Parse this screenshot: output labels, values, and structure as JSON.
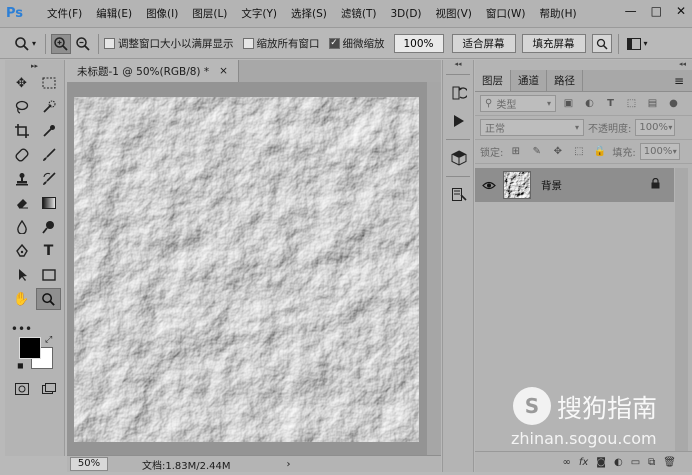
{
  "app": {
    "logo_text": "Ps",
    "menu": [
      "文件(F)",
      "编辑(E)",
      "图像(I)",
      "图层(L)",
      "文字(Y)",
      "选择(S)",
      "滤镜(T)",
      "3D(D)",
      "视图(V)",
      "窗口(W)",
      "帮助(H)"
    ],
    "window_controls": {
      "minimize": "—",
      "maximize": "□",
      "close": "✕"
    }
  },
  "options": {
    "resize_windows_label": "调整窗口大小以满屏显示",
    "resize_windows_checked": false,
    "zoom_all_windows_label": "缩放所有窗口",
    "zoom_all_windows_checked": false,
    "scrubby_zoom_label": "细微缩放",
    "scrubby_zoom_checked": true,
    "zoom_value": "100%",
    "fit_screen_label": "适合屏幕",
    "fill_screen_label": "填充屏幕"
  },
  "document": {
    "tab_title": "未标题-1 @ 50%(RGB/8) *",
    "tab_close": "×",
    "status_zoom": "50%",
    "status_info": "文档:1.83M/2.44M",
    "status_arrow": "›"
  },
  "layers_panel": {
    "tabs": [
      "图层",
      "通道",
      "路径"
    ],
    "active_tab": 0,
    "filter_kind": "类型",
    "blend_mode": "正常",
    "opacity_label": "不透明度:",
    "opacity_value": "100%",
    "lock_label": "锁定:",
    "fill_label": "填充:",
    "fill_value": "100%",
    "layers": [
      {
        "name": "背景",
        "visible": true,
        "locked": true
      }
    ]
  },
  "watermark": {
    "title": "搜狗指南",
    "url": "zhinan.sogou.com"
  },
  "colors": {
    "foreground": "#000000",
    "background": "#ffffff",
    "ps_blue": "#2c7fd6"
  }
}
